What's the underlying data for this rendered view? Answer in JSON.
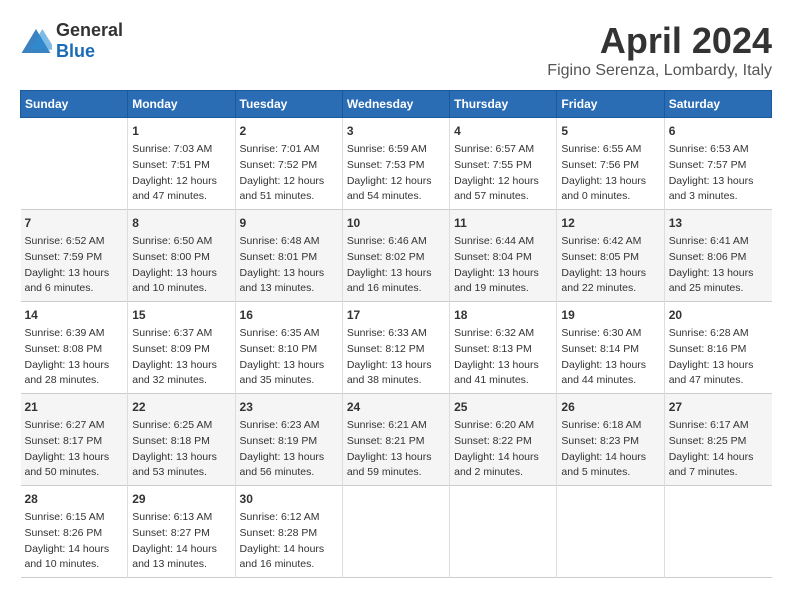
{
  "logo": {
    "general": "General",
    "blue": "Blue"
  },
  "title": "April 2024",
  "subtitle": "Figino Serenza, Lombardy, Italy",
  "columns": [
    "Sunday",
    "Monday",
    "Tuesday",
    "Wednesday",
    "Thursday",
    "Friday",
    "Saturday"
  ],
  "weeks": [
    [
      {
        "day": "",
        "sunrise": "",
        "sunset": "",
        "daylight": ""
      },
      {
        "day": "1",
        "sunrise": "Sunrise: 7:03 AM",
        "sunset": "Sunset: 7:51 PM",
        "daylight": "Daylight: 12 hours and 47 minutes."
      },
      {
        "day": "2",
        "sunrise": "Sunrise: 7:01 AM",
        "sunset": "Sunset: 7:52 PM",
        "daylight": "Daylight: 12 hours and 51 minutes."
      },
      {
        "day": "3",
        "sunrise": "Sunrise: 6:59 AM",
        "sunset": "Sunset: 7:53 PM",
        "daylight": "Daylight: 12 hours and 54 minutes."
      },
      {
        "day": "4",
        "sunrise": "Sunrise: 6:57 AM",
        "sunset": "Sunset: 7:55 PM",
        "daylight": "Daylight: 12 hours and 57 minutes."
      },
      {
        "day": "5",
        "sunrise": "Sunrise: 6:55 AM",
        "sunset": "Sunset: 7:56 PM",
        "daylight": "Daylight: 13 hours and 0 minutes."
      },
      {
        "day": "6",
        "sunrise": "Sunrise: 6:53 AM",
        "sunset": "Sunset: 7:57 PM",
        "daylight": "Daylight: 13 hours and 3 minutes."
      }
    ],
    [
      {
        "day": "7",
        "sunrise": "Sunrise: 6:52 AM",
        "sunset": "Sunset: 7:59 PM",
        "daylight": "Daylight: 13 hours and 6 minutes."
      },
      {
        "day": "8",
        "sunrise": "Sunrise: 6:50 AM",
        "sunset": "Sunset: 8:00 PM",
        "daylight": "Daylight: 13 hours and 10 minutes."
      },
      {
        "day": "9",
        "sunrise": "Sunrise: 6:48 AM",
        "sunset": "Sunset: 8:01 PM",
        "daylight": "Daylight: 13 hours and 13 minutes."
      },
      {
        "day": "10",
        "sunrise": "Sunrise: 6:46 AM",
        "sunset": "Sunset: 8:02 PM",
        "daylight": "Daylight: 13 hours and 16 minutes."
      },
      {
        "day": "11",
        "sunrise": "Sunrise: 6:44 AM",
        "sunset": "Sunset: 8:04 PM",
        "daylight": "Daylight: 13 hours and 19 minutes."
      },
      {
        "day": "12",
        "sunrise": "Sunrise: 6:42 AM",
        "sunset": "Sunset: 8:05 PM",
        "daylight": "Daylight: 13 hours and 22 minutes."
      },
      {
        "day": "13",
        "sunrise": "Sunrise: 6:41 AM",
        "sunset": "Sunset: 8:06 PM",
        "daylight": "Daylight: 13 hours and 25 minutes."
      }
    ],
    [
      {
        "day": "14",
        "sunrise": "Sunrise: 6:39 AM",
        "sunset": "Sunset: 8:08 PM",
        "daylight": "Daylight: 13 hours and 28 minutes."
      },
      {
        "day": "15",
        "sunrise": "Sunrise: 6:37 AM",
        "sunset": "Sunset: 8:09 PM",
        "daylight": "Daylight: 13 hours and 32 minutes."
      },
      {
        "day": "16",
        "sunrise": "Sunrise: 6:35 AM",
        "sunset": "Sunset: 8:10 PM",
        "daylight": "Daylight: 13 hours and 35 minutes."
      },
      {
        "day": "17",
        "sunrise": "Sunrise: 6:33 AM",
        "sunset": "Sunset: 8:12 PM",
        "daylight": "Daylight: 13 hours and 38 minutes."
      },
      {
        "day": "18",
        "sunrise": "Sunrise: 6:32 AM",
        "sunset": "Sunset: 8:13 PM",
        "daylight": "Daylight: 13 hours and 41 minutes."
      },
      {
        "day": "19",
        "sunrise": "Sunrise: 6:30 AM",
        "sunset": "Sunset: 8:14 PM",
        "daylight": "Daylight: 13 hours and 44 minutes."
      },
      {
        "day": "20",
        "sunrise": "Sunrise: 6:28 AM",
        "sunset": "Sunset: 8:16 PM",
        "daylight": "Daylight: 13 hours and 47 minutes."
      }
    ],
    [
      {
        "day": "21",
        "sunrise": "Sunrise: 6:27 AM",
        "sunset": "Sunset: 8:17 PM",
        "daylight": "Daylight: 13 hours and 50 minutes."
      },
      {
        "day": "22",
        "sunrise": "Sunrise: 6:25 AM",
        "sunset": "Sunset: 8:18 PM",
        "daylight": "Daylight: 13 hours and 53 minutes."
      },
      {
        "day": "23",
        "sunrise": "Sunrise: 6:23 AM",
        "sunset": "Sunset: 8:19 PM",
        "daylight": "Daylight: 13 hours and 56 minutes."
      },
      {
        "day": "24",
        "sunrise": "Sunrise: 6:21 AM",
        "sunset": "Sunset: 8:21 PM",
        "daylight": "Daylight: 13 hours and 59 minutes."
      },
      {
        "day": "25",
        "sunrise": "Sunrise: 6:20 AM",
        "sunset": "Sunset: 8:22 PM",
        "daylight": "Daylight: 14 hours and 2 minutes."
      },
      {
        "day": "26",
        "sunrise": "Sunrise: 6:18 AM",
        "sunset": "Sunset: 8:23 PM",
        "daylight": "Daylight: 14 hours and 5 minutes."
      },
      {
        "day": "27",
        "sunrise": "Sunrise: 6:17 AM",
        "sunset": "Sunset: 8:25 PM",
        "daylight": "Daylight: 14 hours and 7 minutes."
      }
    ],
    [
      {
        "day": "28",
        "sunrise": "Sunrise: 6:15 AM",
        "sunset": "Sunset: 8:26 PM",
        "daylight": "Daylight: 14 hours and 10 minutes."
      },
      {
        "day": "29",
        "sunrise": "Sunrise: 6:13 AM",
        "sunset": "Sunset: 8:27 PM",
        "daylight": "Daylight: 14 hours and 13 minutes."
      },
      {
        "day": "30",
        "sunrise": "Sunrise: 6:12 AM",
        "sunset": "Sunset: 8:28 PM",
        "daylight": "Daylight: 14 hours and 16 minutes."
      },
      {
        "day": "",
        "sunrise": "",
        "sunset": "",
        "daylight": ""
      },
      {
        "day": "",
        "sunrise": "",
        "sunset": "",
        "daylight": ""
      },
      {
        "day": "",
        "sunrise": "",
        "sunset": "",
        "daylight": ""
      },
      {
        "day": "",
        "sunrise": "",
        "sunset": "",
        "daylight": ""
      }
    ]
  ]
}
